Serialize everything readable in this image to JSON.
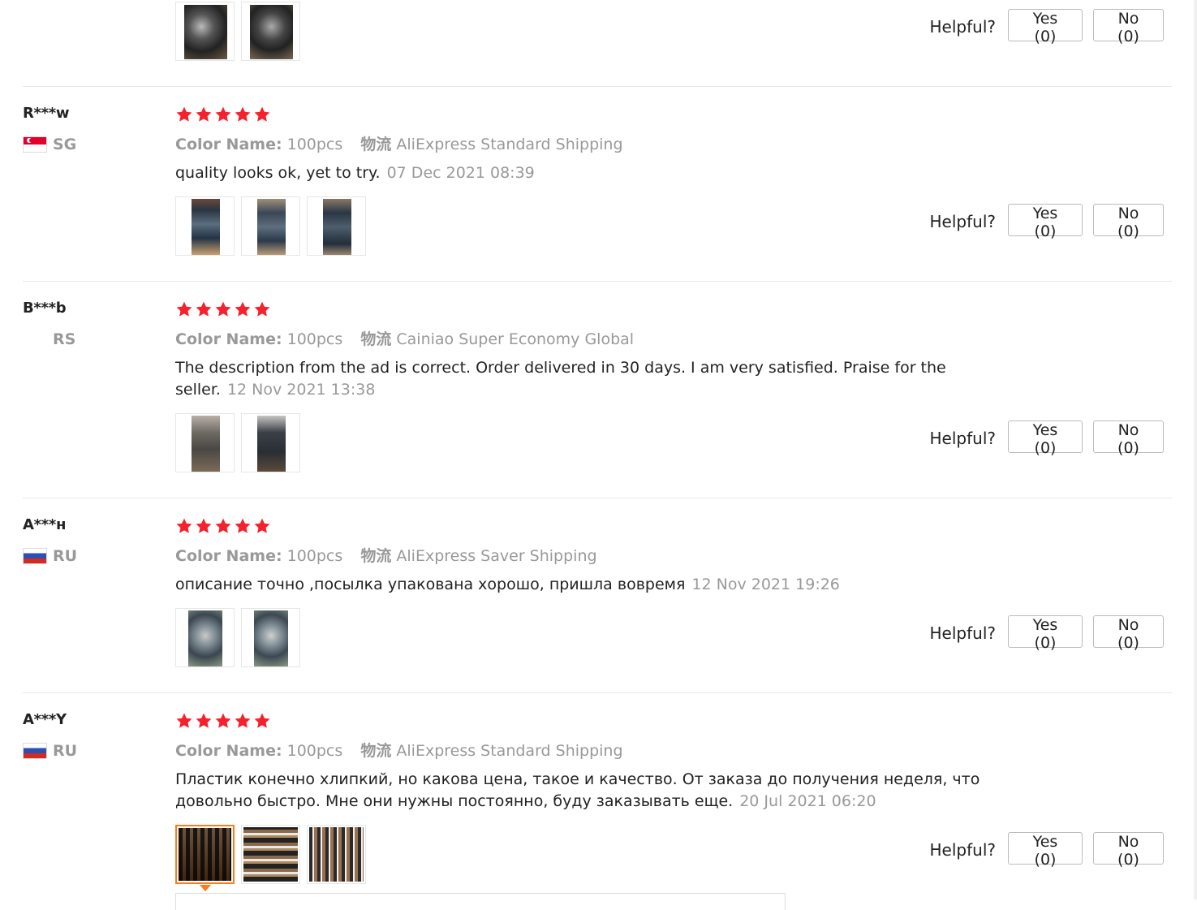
{
  "helpful_label": "Helpful?",
  "color_key": "Color Name:",
  "ship_key": "物流",
  "top_partial": {
    "yes": "Yes (0)",
    "no": "No (0)"
  },
  "reviews": [
    {
      "user": "R***w",
      "country": "SG",
      "flag": "sg",
      "rating": 5,
      "color": "100pcs",
      "shipping": "AliExpress Standard Shipping",
      "text": "quality looks ok, yet to try.",
      "date": "07 Dec 2021 08:39",
      "yes": "Yes (0)",
      "no": "No (0)"
    },
    {
      "user": "B***b",
      "country": "RS",
      "flag": "none",
      "rating": 5,
      "color": "100pcs",
      "shipping": "Cainiao Super Economy Global",
      "text": "The description from the ad is correct. Order delivered in 30 days. I am very satisfied. Praise for the seller.",
      "date": "12 Nov 2021 13:38",
      "yes": "Yes (0)",
      "no": "No (0)"
    },
    {
      "user": "A***н",
      "country": "RU",
      "flag": "ru",
      "rating": 5,
      "color": "100pcs",
      "shipping": "AliExpress Saver Shipping",
      "text": "описание точно ,посылка упакована хорошо, пришла вовремя",
      "date": "12 Nov 2021 19:26",
      "yes": "Yes (0)",
      "no": "No (0)"
    },
    {
      "user": "A***Y",
      "country": "RU",
      "flag": "ru",
      "rating": 5,
      "color": "100pcs",
      "shipping": "AliExpress Standard Shipping",
      "text": "Пластик конечно хлипкий, но какова цена, такое и качество. От заказа до получения неделя, что довольно быстро. Мне они нужны постоянно, буду заказывать еще.",
      "date": "20 Jul 2021 06:20",
      "yes": "Yes (0)",
      "no": "No (0)"
    }
  ],
  "colors": {
    "star": "#f5222d",
    "muted": "#999999",
    "active_border": "#ff7a1a"
  }
}
